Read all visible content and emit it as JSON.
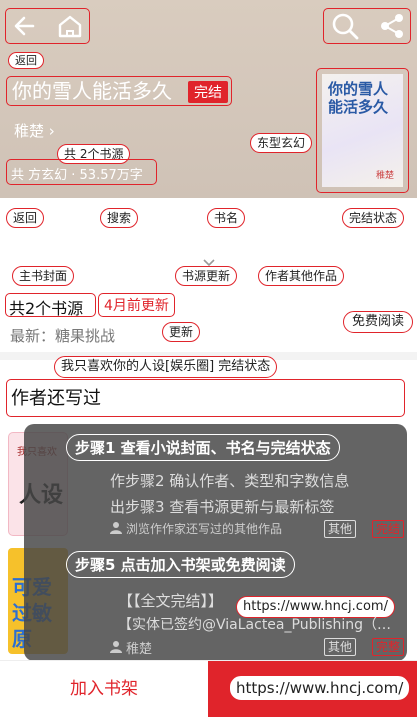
{
  "header": {
    "back_label": "返回",
    "title": "你的雪人能活多久",
    "status_badge": "完结",
    "author": "稚楚 ›",
    "meta": "共 方玄幻 · 53.57万字",
    "source_count_note": "共 2个书源",
    "genre_note": "东型玄幻",
    "cover_title": "你的雪人能活多久",
    "cover_author": "稚楚"
  },
  "annotations": {
    "back": "返回",
    "search": "搜索",
    "book_name": "书名",
    "completion": "完结状态",
    "main_cover": "主书封面",
    "source_update": "书源更新",
    "author_other": "作者其他作品",
    "update_tag": "更新",
    "free_read": "免费阅读",
    "rec_title": "我只喜欢你的人设[娱乐圈]  完结状态"
  },
  "sources": {
    "label": "共2个书源",
    "updated": "4月前更新",
    "latest": "最新：糖果挑战"
  },
  "section_title": "作者还写过",
  "list": [
    {
      "cover_text": "人设",
      "cover_sub": "我只喜欢",
      "author": "浏览作作家还写过的其他作品",
      "tag_other": "其他",
      "tag_status": "完结"
    },
    {
      "cover_text": "可爱 过敏原",
      "line1": "【【全文完结】】",
      "line2": "【实体已签约@ViaLactea_Publishing（…",
      "author": "稚楚",
      "tag_other": "其他",
      "tag_status": "完整"
    }
  ],
  "overlay": {
    "step1": "步骤1 查看小说封面、书名与完结状态",
    "step2": "作步骤2  确认作者、类型和字数信息",
    "step3": "出步骤3  查看书源更新与最新标签",
    "step5": "步骤5 点击加入书架或免费阅读",
    "url_mid": "https://www.hncj.com/"
  },
  "bottom": {
    "add_shelf": "加入书架",
    "url": "https://www.hncj.com/"
  },
  "colors": {
    "accent": "#e0242b",
    "header_bg": "#d6c9bc"
  }
}
